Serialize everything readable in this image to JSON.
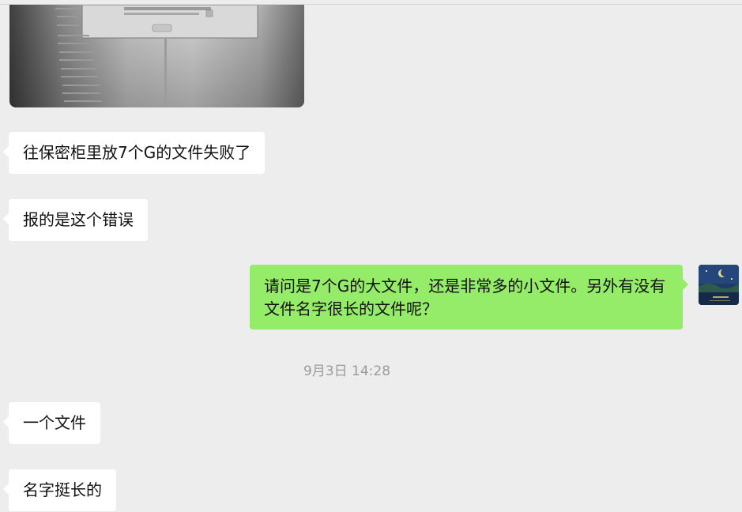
{
  "messages": {
    "received_1": "往保密柜里放7个G的文件失败了",
    "received_2": "报的是这个错误",
    "sent_1": "请问是7个G的大文件，还是非常多的小文件。另外有没有文件名字很长的文件呢？",
    "received_3": "一个文件",
    "received_4": "名字挺长的"
  },
  "timestamp": "9月3日 14:28",
  "colors": {
    "background": "#ededed",
    "incoming_bubble": "#ffffff",
    "outgoing_bubble": "#95ec69",
    "timestamp_text": "#9b9b9b"
  },
  "icons": {
    "avatar": "night-landscape-avatar",
    "photo": "error-dialog-photo"
  }
}
